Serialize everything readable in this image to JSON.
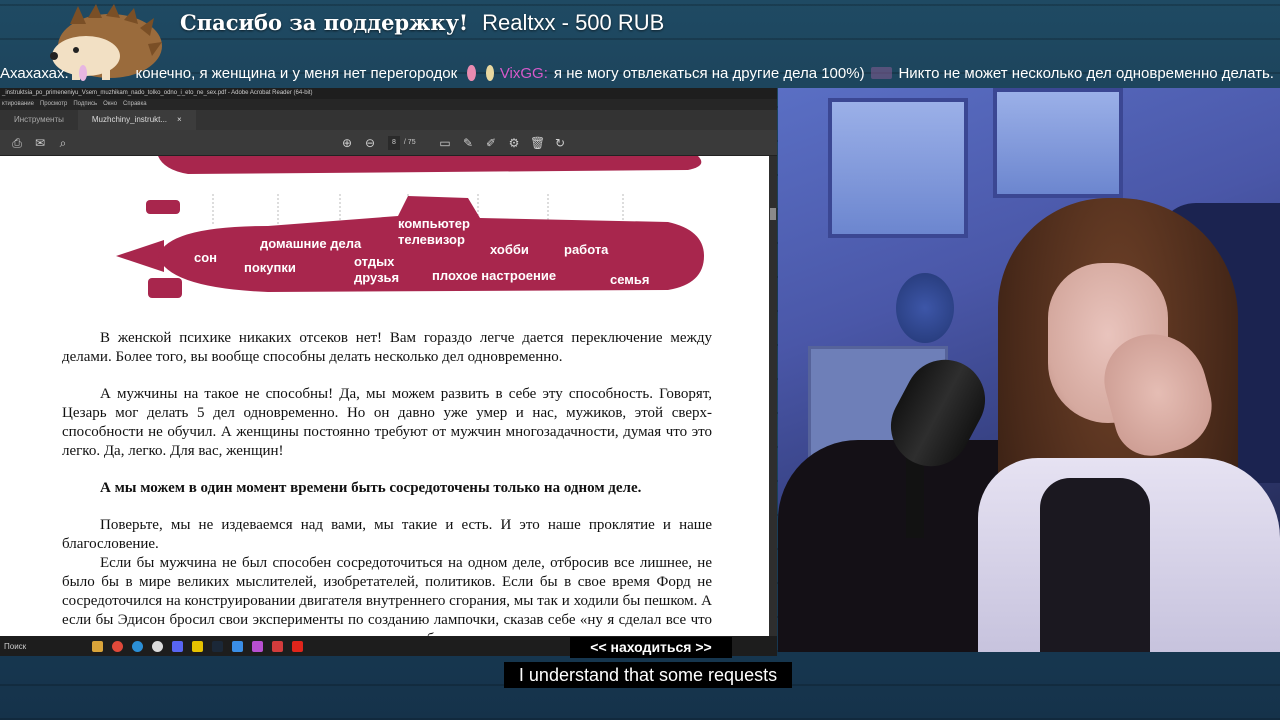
{
  "donation": {
    "thanks": "Спасибо за поддержку!",
    "donor_line": "Realtxx - 500 RUB"
  },
  "chat": {
    "msg0": "Ахахахах.",
    "msg1_text": "конечно, я женщина и у меня нет перегородок",
    "msg2_user": "VixGG:",
    "msg2_text": "я не могу отвлекаться на другие дела 100%)",
    "msg3_text": "Никто не может несколько дел одновременно делать."
  },
  "acrobat": {
    "window_title": "_instruktsia_po_primeneniyu_Vsem_muzhikam_nado_tolko_odno_i_eto_ne_sex.pdf - Adobe Acrobat Reader (64-bit)",
    "menu": [
      "ктирование",
      "Просмотр",
      "Подпись",
      "Окно",
      "Справка"
    ],
    "tabs": {
      "tools": "Инструменты",
      "doc": "Muzhchiny_instrukt...",
      "close": "×"
    },
    "page_current": "8",
    "page_total": "/ 75",
    "submarine_labels": [
      "сон",
      "домашние дела",
      "компьютер",
      "телевизор",
      "хобби",
      "работа",
      "покупки",
      "отдых",
      "друзья",
      "плохое настроение",
      "семья"
    ],
    "paragraphs": {
      "p1": "В женской психике никаких отсеков нет! Вам гораздо легче дается переключение между делами. Более того, вы вообще способны делать несколько дел одновременно.",
      "p2": "А мужчины на такое не способны! Да, мы можем развить в себе эту способность. Говорят, Цезарь мог делать 5 дел одновременно. Но он давно уже умер и нас, мужиков, этой сверх-способности не обучил. А женщины постоянно требуют от мужчин многозадачности, думая что это легко. Да, легко. Для вас, женщин!",
      "p3": "А мы можем в один момент времени быть сосредоточены только на одном деле.",
      "p4": "Поверьте, мы не издеваемся над вами, мы такие и есть. И это наше проклятие и наше благословение.",
      "p5": "Если бы мужчина не был способен сосредоточиться на одном деле, отбросив все лишнее, не было бы в мире великих мыслителей, изобретателей, политиков. Если бы в свое время Форд не сосредоточился на конструировании двигателя внутреннего сгорания, мы так и ходили бы пешком. А если бы Эдисон бросил свои эксперименты по созданию лампочки, сказав себе «ну я сделал все что мог, пора заняться другими делами», то мы так и сидели бы"
    }
  },
  "taskbar": {
    "search": "Поиск"
  },
  "captions": {
    "overlay": "<< находиться >>",
    "subtitle": "I understand that some requests"
  },
  "colors": {
    "submarine": "#a8264d",
    "background": "#1b4560"
  }
}
